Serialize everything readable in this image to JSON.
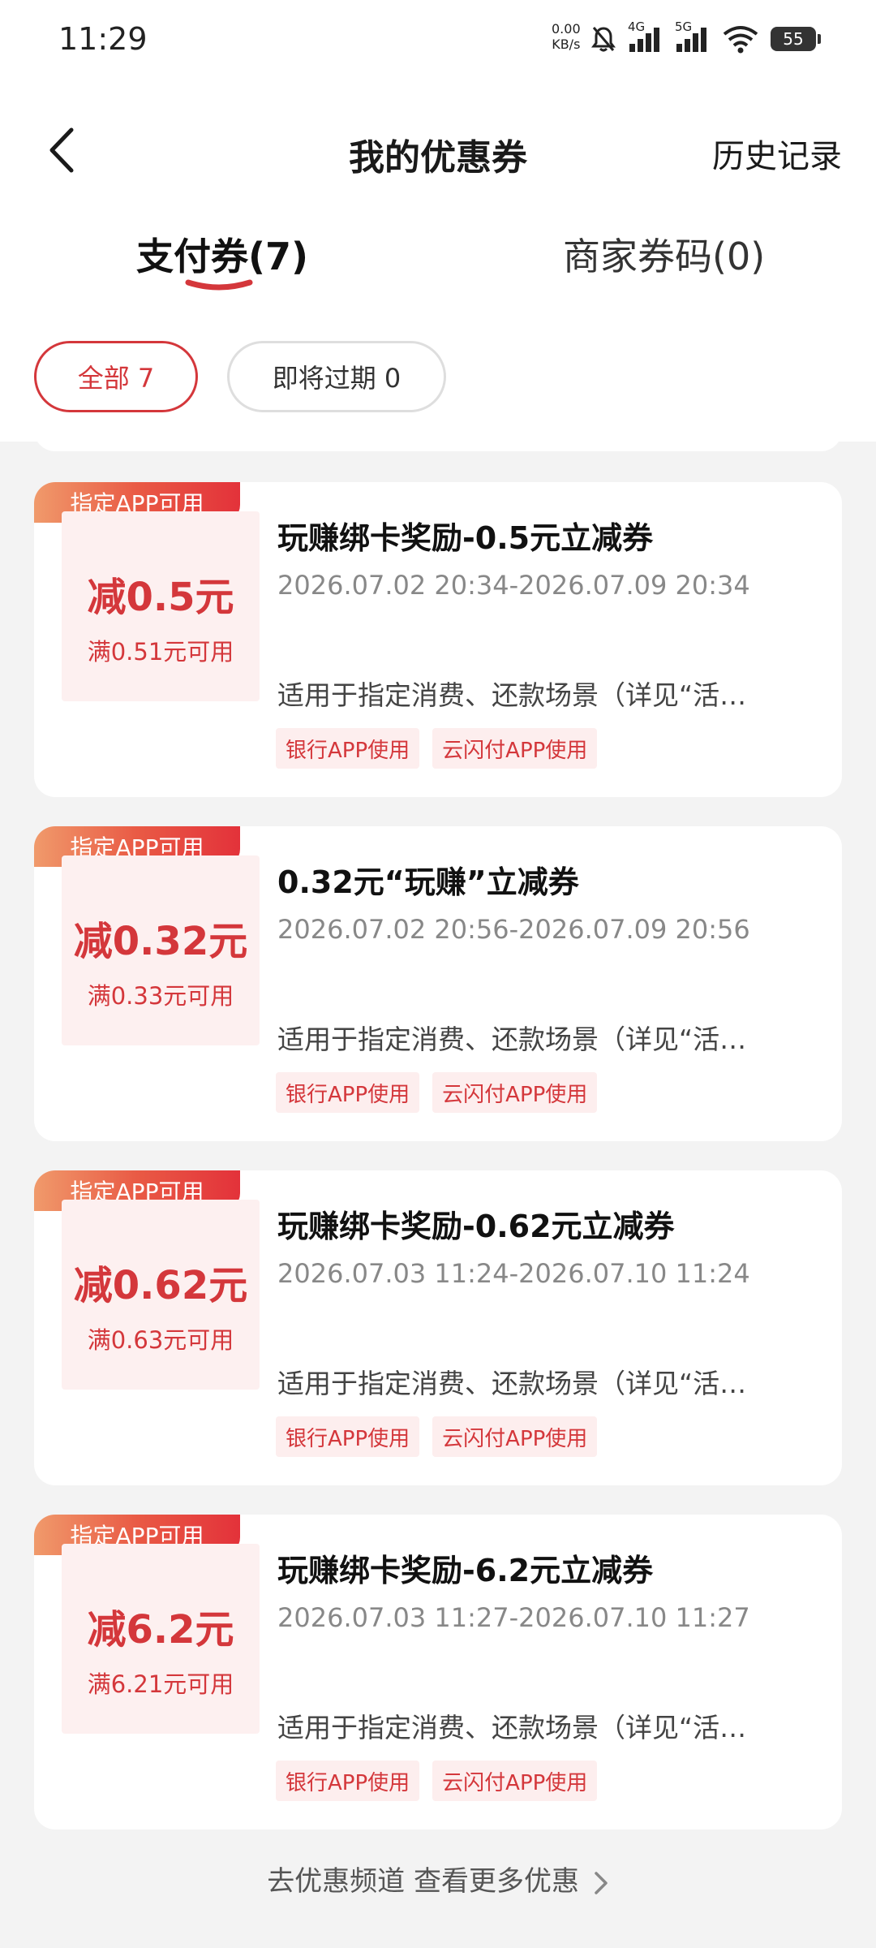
{
  "status_bar": {
    "time": "11:29",
    "net_speed_value": "0.00",
    "net_speed_unit": "KB/s",
    "sig1_label": "4G",
    "sig2_label": "5G",
    "battery": "55"
  },
  "header": {
    "title": "我的优惠券",
    "history": "历史记录"
  },
  "tabs": [
    {
      "label": "支付券(7)",
      "active": true
    },
    {
      "label": "商家券码(0)",
      "active": false
    }
  ],
  "filters": [
    {
      "label": "全部 7",
      "active": true
    },
    {
      "label": "即将过期 0",
      "active": false
    }
  ],
  "coupons": [
    {
      "badge": "指定APP可用",
      "amount": "减0.5元",
      "threshold": "满0.51元可用",
      "title": "玩赚绑卡奖励-0.5元立减券",
      "validity": "2026.07.02 20:34-2026.07.09 20:34",
      "description": "适用于指定消费、还款场景（详见“活…",
      "tags": [
        "银行APP使用",
        "云闪付APP使用"
      ]
    },
    {
      "badge": "指定APP可用",
      "amount": "减0.32元",
      "threshold": "满0.33元可用",
      "title": "0.32元“玩赚”立减券",
      "validity": "2026.07.02 20:56-2026.07.09 20:56",
      "description": "适用于指定消费、还款场景（详见“活…",
      "tags": [
        "银行APP使用",
        "云闪付APP使用"
      ]
    },
    {
      "badge": "指定APP可用",
      "amount": "减0.62元",
      "threshold": "满0.63元可用",
      "title": "玩赚绑卡奖励-0.62元立减券",
      "validity": "2026.07.03 11:24-2026.07.10 11:24",
      "description": "适用于指定消费、还款场景（详见“活…",
      "tags": [
        "银行APP使用",
        "云闪付APP使用"
      ]
    },
    {
      "badge": "指定APP可用",
      "amount": "减6.2元",
      "threshold": "满6.21元可用",
      "title": "玩赚绑卡奖励-6.2元立减券",
      "validity": "2026.07.03 11:27-2026.07.10 11:27",
      "description": "适用于指定消费、还款场景（详见“活…",
      "tags": [
        "银行APP使用",
        "云闪付APP使用"
      ]
    }
  ],
  "footer": {
    "more": "去优惠频道 查看更多优惠"
  },
  "colors": {
    "accent": "#d4373b",
    "badge_gradient_start": "#f09a6b",
    "badge_gradient_end": "#e3323a",
    "background": "#f3f3f3"
  },
  "icons": [
    "back-arrow-icon",
    "bell-muted-icon",
    "signal-icon",
    "wifi-icon",
    "battery-icon",
    "chevron-right-icon"
  ]
}
